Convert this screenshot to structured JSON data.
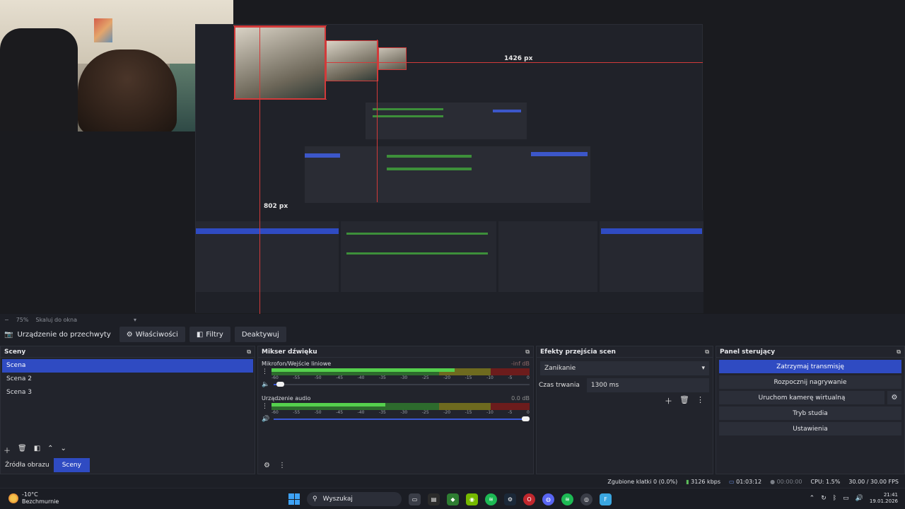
{
  "preview": {
    "px_label_top": "1426 px",
    "px_label_left": "802 px",
    "nested_px_label": "802 px"
  },
  "zoom_bar": {
    "minus": "−",
    "zoom": "75%",
    "scale_mode": "Skaluj do okna"
  },
  "source_bar": {
    "source_name": "Urządzenie do przechwyty",
    "properties_label": "Właściwości",
    "filters_label": "Filtry",
    "deactivate_label": "Deaktywuj"
  },
  "scenes": {
    "title": "Sceny",
    "items": [
      {
        "label": "Scena"
      },
      {
        "label": "Scena 2"
      },
      {
        "label": "Scena 3"
      }
    ],
    "tabs": {
      "sources": "Źródła obrazu",
      "scenes": "Sceny"
    }
  },
  "mixer": {
    "title": "Mikser dźwięku",
    "channels": [
      {
        "name": "Mikrofon/Wejście liniowe",
        "db": "-inf dB",
        "level": 0.71,
        "volume": 0.01
      },
      {
        "name": "Urządzenie audio",
        "db": "0.0 dB",
        "level": 0.44,
        "volume": 1.0
      }
    ],
    "ticks": [
      "-60",
      "-55",
      "-50",
      "-45",
      "-40",
      "-35",
      "-30",
      "-25",
      "-20",
      "-15",
      "-10",
      "-5",
      "0"
    ]
  },
  "transitions": {
    "title": "Efekty przejścia scen",
    "selected": "Zanikanie",
    "duration_label": "Czas trwania",
    "duration_value": "1300 ms"
  },
  "controls": {
    "title": "Panel sterujący",
    "stop_stream": "Zatrzymaj transmisję",
    "start_recording": "Rozpocznij nagrywanie",
    "start_virtualcam": "Uruchom kamerę wirtualną",
    "studio_mode": "Tryb studia",
    "settings": "Ustawienia"
  },
  "status": {
    "dropped_frames": "Zgubione klatki 0 (0.0%)",
    "bitrate": "3126 kbps",
    "stream_time": "01:03:12",
    "rec_time": "00:00:00",
    "cpu": "CPU: 1.5%",
    "fps": "30.00 / 30.00 FPS"
  },
  "taskbar": {
    "temperature": "-10°C",
    "weather": "Bezchmurnie",
    "search_placeholder": "Wyszukaj",
    "time": "21:41",
    "date": "19.01.2026"
  },
  "colors": {
    "accent": "#2f4bc2",
    "meter_green": "#55d04d",
    "selection_red": "#d23a3a"
  }
}
